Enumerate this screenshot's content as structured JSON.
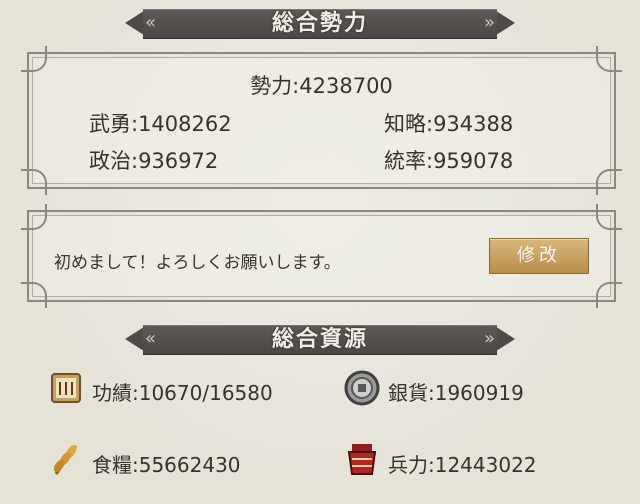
{
  "power_section": {
    "title": "総合勢力",
    "total_label": "勢力:4238700",
    "stats": {
      "valor": "武勇:1408262",
      "wisdom": "知略:934388",
      "politics": "政治:936972",
      "command": "統率:959078"
    }
  },
  "profile": {
    "message": "初めまして！よろしくお願いします。",
    "edit_label": "修改"
  },
  "resource_section": {
    "title": "総合資源",
    "merit": "功績:10670/16580",
    "silver": "銀貨:1960919",
    "food": "食糧:55662430",
    "troops": "兵力:12443022"
  },
  "icons": {
    "merit": "scroll-icon",
    "silver": "silver-coin-icon",
    "food": "wheat-icon",
    "troops": "armor-icon"
  }
}
